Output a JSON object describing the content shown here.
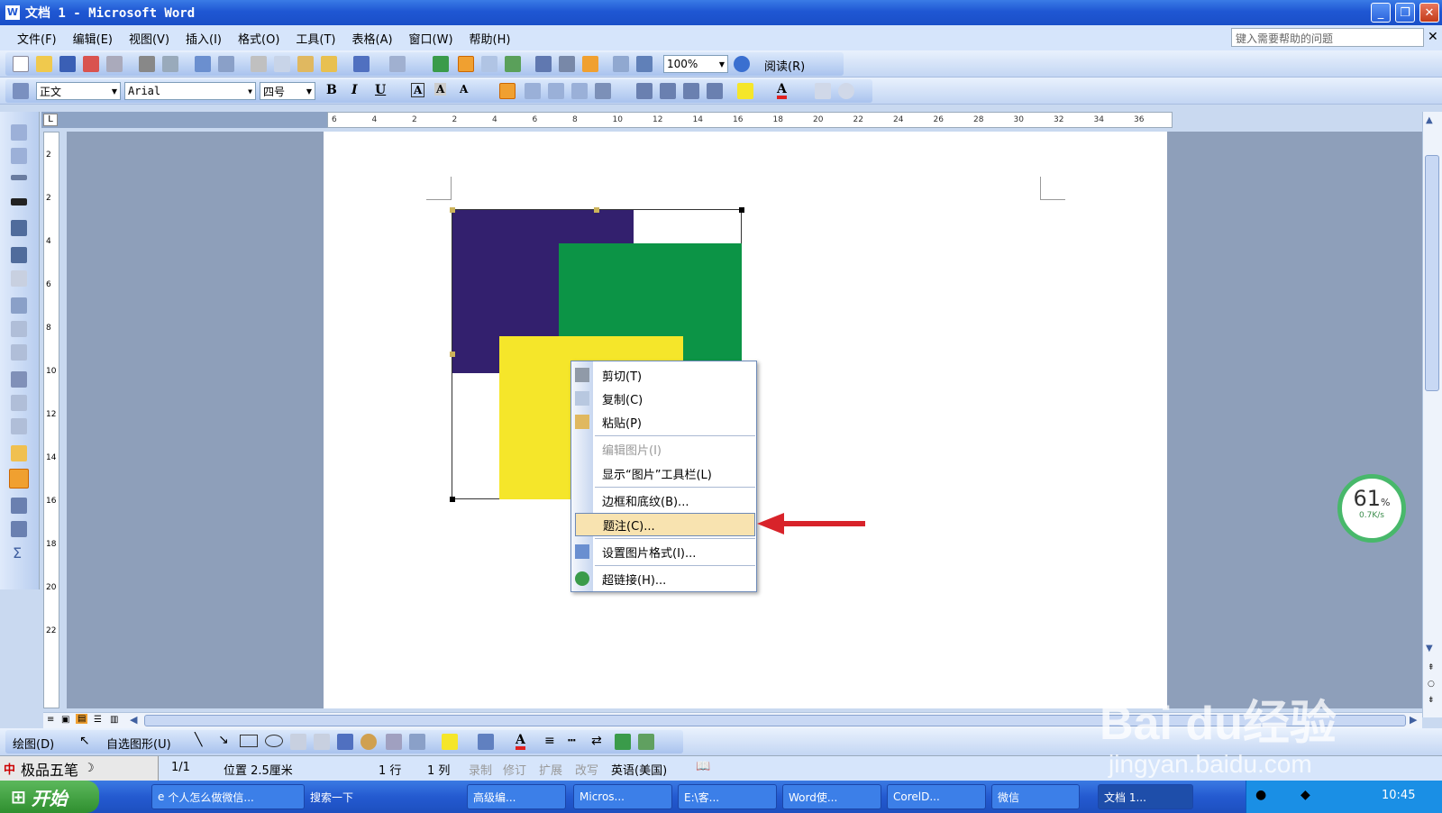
{
  "window": {
    "title": "文档 1 - Microsoft Word"
  },
  "menu": [
    "文件(F)",
    "编辑(E)",
    "视图(V)",
    "插入(I)",
    "格式(O)",
    "工具(T)",
    "表格(A)",
    "窗口(W)",
    "帮助(H)"
  ],
  "help_placeholder": "键入需要帮助的问题",
  "standard_toolbar": {
    "zoom": "100%",
    "read_label": "阅读(R)"
  },
  "format_toolbar": {
    "style": "正文",
    "font": "Arial",
    "size": "四号"
  },
  "ruler_labels": [
    "6",
    "4",
    "2",
    "2",
    "4",
    "6",
    "8",
    "10",
    "12",
    "14",
    "16",
    "18",
    "20",
    "22",
    "24",
    "26",
    "28",
    "30",
    "32",
    "34",
    "36"
  ],
  "ruler_v_labels": [
    "2",
    "2",
    "4",
    "6",
    "8",
    "10",
    "12",
    "14",
    "16",
    "18",
    "20",
    "22"
  ],
  "context_menu": {
    "items": [
      {
        "label": "剪切(T)",
        "icon": "scissors-icon",
        "enabled": true
      },
      {
        "label": "复制(C)",
        "icon": "copy-icon",
        "enabled": true
      },
      {
        "label": "粘贴(P)",
        "icon": "paste-icon",
        "enabled": true
      },
      {
        "label": "编辑图片(I)",
        "icon": "",
        "enabled": false
      },
      {
        "label": "显示“图片”工具栏(L)",
        "icon": "",
        "enabled": true
      },
      {
        "label": "边框和底纹(B)...",
        "icon": "",
        "enabled": true
      },
      {
        "label": "题注(C)...",
        "icon": "",
        "enabled": true,
        "highlighted": true
      },
      {
        "label": "设置图片格式(I)...",
        "icon": "format-picture-icon",
        "enabled": true
      },
      {
        "label": "超链接(H)...",
        "icon": "hyperlink-icon",
        "enabled": true
      }
    ]
  },
  "image_colors": {
    "purple": "#33206e",
    "green": "#0c9446",
    "yellow": "#f5e62a"
  },
  "draw_toolbar": {
    "draw": "绘图(D)",
    "autoshapes": "自选图形(U)"
  },
  "status_bar": {
    "ime": "极品五笔",
    "page": "1/1",
    "position": "位置 2.5厘米",
    "line": "1 行",
    "col": "1 列",
    "rec": "录制",
    "rev": "修订",
    "ext": "扩展",
    "ovr": "改写",
    "lang": "英语(美国)"
  },
  "taskbar": {
    "start": "开始",
    "items": [
      "个人怎么做微信...",
      "搜索一下",
      "高级编...",
      "Micros...",
      "E:\\客...",
      "Word使...",
      "CorelD...",
      "微信",
      "文档 1..."
    ],
    "clock": "10:45"
  },
  "speed_widget": {
    "percent": "61",
    "percent_sign": "%",
    "rate": "0.7K/s"
  },
  "watermark": {
    "brand": "Bai du经验",
    "url": "jingyan.baidu.com"
  }
}
